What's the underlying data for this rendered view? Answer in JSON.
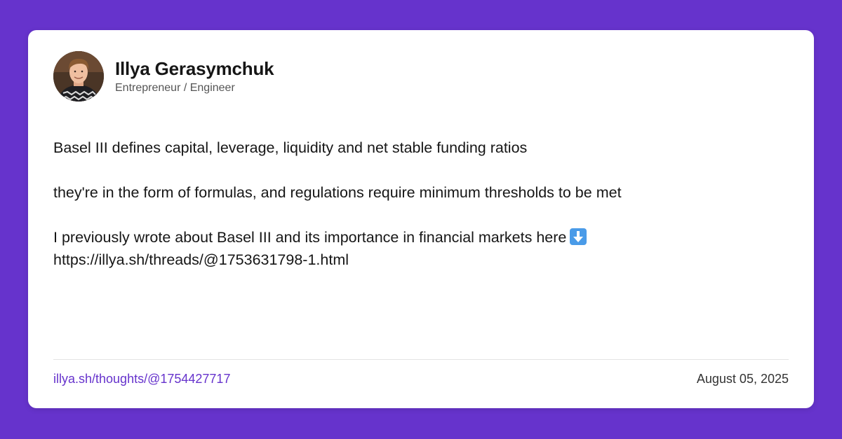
{
  "author": {
    "name": "Illya Gerasymchuk",
    "title": "Entrepreneur / Engineer",
    "avatar_icon": "profile-photo"
  },
  "post": {
    "line1": "Basel III defines capital, leverage, liquidity and net stable funding ratios",
    "line2": "they're in the form of formulas, and regulations require minimum thresholds to be met",
    "line3": "I previously wrote about Basel III and its importance in financial markets here",
    "line3_emoji": "down-arrow-icon",
    "url": "https://illya.sh/threads/@1753631798-1.html"
  },
  "footer": {
    "link": "illya.sh/thoughts/@1754427717",
    "date": "August 05, 2025"
  },
  "colors": {
    "background": "#6633cc",
    "card": "#ffffff",
    "link": "#6633cc",
    "text": "#161616"
  }
}
